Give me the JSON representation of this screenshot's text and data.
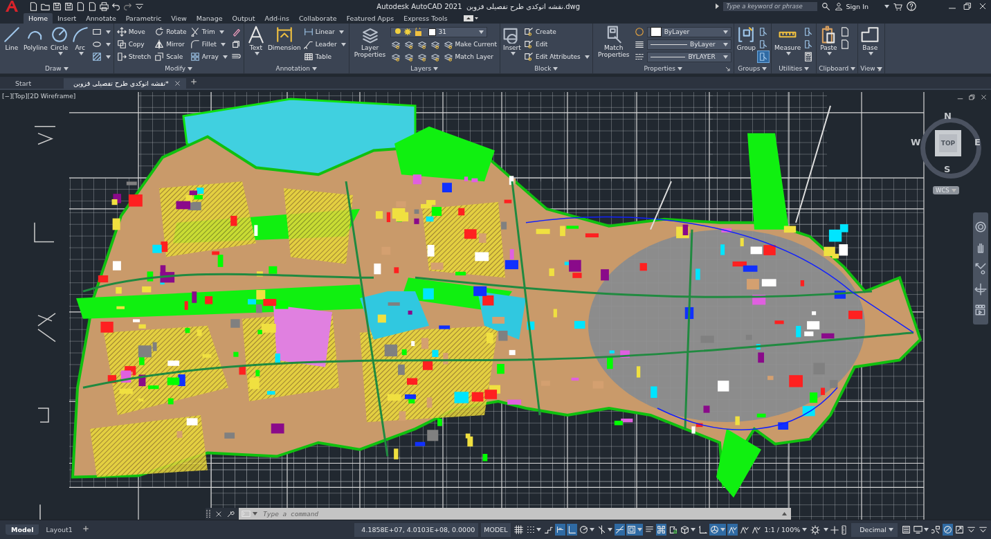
{
  "title_bar": {
    "app_title": "Autodesk AutoCAD 2021",
    "file_name": "نقشه اتوکدی طرح تفصیلی قزوین.dwg",
    "search_placeholder": "Type a keyword or phrase",
    "sign_in": "Sign In"
  },
  "ribbon_tabs": [
    {
      "label": "Home",
      "selected": true
    },
    {
      "label": "Insert",
      "selected": false
    },
    {
      "label": "Annotate",
      "selected": false
    },
    {
      "label": "Parametric",
      "selected": false
    },
    {
      "label": "View",
      "selected": false
    },
    {
      "label": "Manage",
      "selected": false
    },
    {
      "label": "Output",
      "selected": false
    },
    {
      "label": "Add-ins",
      "selected": false
    },
    {
      "label": "Collaborate",
      "selected": false
    },
    {
      "label": "Featured Apps",
      "selected": false
    },
    {
      "label": "Express Tools",
      "selected": false
    }
  ],
  "ribbon_panels": [
    {
      "title": "Draw",
      "launcher": false,
      "large": [
        {
          "label": "Line",
          "dropdown": false
        },
        {
          "label": "Polyline",
          "dropdown": false
        },
        {
          "label": "Circle",
          "dropdown": true
        },
        {
          "label": "Arc",
          "dropdown": true
        }
      ],
      "rows": [
        [
          {
            "kind": "icon",
            "dropdown": true,
            "on": false
          }
        ],
        [
          {
            "kind": "icon",
            "dropdown": true,
            "on": false
          }
        ],
        [
          {
            "kind": "icon",
            "dropdown": true,
            "on": false
          }
        ]
      ]
    },
    {
      "title": "Modify",
      "launcher": false,
      "rows": [
        [
          {
            "kind": "button",
            "label": "Move",
            "dropdown": false
          },
          {
            "kind": "button",
            "label": "Rotate",
            "dropdown": false
          },
          {
            "kind": "button",
            "label": "Trim",
            "dropdown": true
          },
          {
            "kind": "icon",
            "dropdown": false,
            "on": false
          }
        ],
        [
          {
            "kind": "button",
            "label": "Copy",
            "dropdown": false
          },
          {
            "kind": "button",
            "label": "Mirror",
            "dropdown": false
          },
          {
            "kind": "button",
            "label": "Fillet",
            "dropdown": true
          },
          {
            "kind": "icon",
            "dropdown": false,
            "on": false
          }
        ],
        [
          {
            "kind": "button",
            "label": "Stretch",
            "dropdown": false
          },
          {
            "kind": "button",
            "label": "Scale",
            "dropdown": false
          },
          {
            "kind": "button",
            "label": "Array",
            "dropdown": true
          },
          {
            "kind": "icon",
            "dropdown": false,
            "on": false
          }
        ]
      ]
    },
    {
      "title": "Annotation",
      "launcher": false,
      "large": [
        {
          "label": "Text",
          "dropdown": true
        },
        {
          "label": "Dimension",
          "dropdown": false
        }
      ],
      "rows": [
        [
          {
            "kind": "button",
            "label": "Linear",
            "dropdown": true
          }
        ],
        [
          {
            "kind": "button",
            "label": "Leader",
            "dropdown": true
          }
        ],
        [
          {
            "kind": "button",
            "label": "Table",
            "dropdown": false
          }
        ]
      ]
    },
    {
      "title": "Layers",
      "launcher": false,
      "large": [
        {
          "label": "Layer Properties",
          "dropdown": false
        }
      ],
      "rows": [
        [
          {
            "kind": "layer-select",
            "value": "31"
          }
        ],
        [
          {
            "kind": "icon",
            "dropdown": false,
            "on": false
          },
          {
            "kind": "icon",
            "dropdown": false,
            "on": false
          },
          {
            "kind": "icon",
            "dropdown": false,
            "on": false
          },
          {
            "kind": "icon",
            "dropdown": false,
            "on": false
          },
          {
            "kind": "button",
            "label": "Make Current",
            "dropdown": false
          }
        ],
        [
          {
            "kind": "icon",
            "dropdown": false,
            "on": false
          },
          {
            "kind": "icon",
            "dropdown": false,
            "on": false
          },
          {
            "kind": "icon",
            "dropdown": false,
            "on": false
          },
          {
            "kind": "icon",
            "dropdown": false,
            "on": false
          },
          {
            "kind": "button",
            "label": "Match Layer",
            "dropdown": false
          }
        ]
      ]
    },
    {
      "title": "Block",
      "launcher": false,
      "large": [
        {
          "label": "Insert",
          "dropdown": true
        }
      ],
      "rows": [
        [
          {
            "kind": "button",
            "label": "Create",
            "dropdown": false
          }
        ],
        [
          {
            "kind": "button",
            "label": "Edit",
            "dropdown": false
          }
        ],
        [
          {
            "kind": "button",
            "label": "Edit Attributes",
            "dropdown": true
          }
        ]
      ]
    },
    {
      "title": "Properties",
      "launcher": true,
      "large": [
        {
          "label": "Match Properties",
          "dropdown": false
        }
      ],
      "rows": [
        [
          {
            "kind": "icon",
            "dropdown": false,
            "on": false
          },
          {
            "kind": "color-select",
            "value": "ByLayer"
          }
        ],
        [
          {
            "kind": "icon",
            "dropdown": false,
            "on": false
          },
          {
            "kind": "line-select",
            "value": "ByLayer"
          }
        ],
        [
          {
            "kind": "icon",
            "dropdown": false,
            "on": false
          },
          {
            "kind": "line-select",
            "value": "BYLAYER"
          }
        ]
      ]
    },
    {
      "title": "Groups",
      "launcher": false,
      "large": [
        {
          "label": "Group",
          "dropdown": false
        }
      ],
      "rows": [
        [
          {
            "kind": "icon",
            "dropdown": false,
            "on": false
          }
        ],
        [
          {
            "kind": "icon",
            "dropdown": false,
            "on": false
          }
        ],
        [
          {
            "kind": "icon",
            "dropdown": false,
            "on": true
          }
        ]
      ]
    },
    {
      "title": "Utilities",
      "launcher": false,
      "large": [
        {
          "label": "Measure",
          "dropdown": true
        }
      ],
      "rows": [
        [
          {
            "kind": "icon",
            "dropdown": false,
            "on": false
          }
        ],
        [
          {
            "kind": "icon",
            "dropdown": false,
            "on": false
          }
        ],
        [
          {
            "kind": "icon",
            "dropdown": false,
            "on": false
          }
        ]
      ]
    },
    {
      "title": "Clipboard",
      "launcher": false,
      "large": [
        {
          "label": "Paste",
          "dropdown": true
        }
      ],
      "rows": [
        [
          {
            "kind": "icon",
            "dropdown": false,
            "on": false
          }
        ],
        [
          {
            "kind": "icon",
            "dropdown": false,
            "on": false
          }
        ]
      ]
    },
    {
      "title": "View",
      "launcher": true,
      "large": [
        {
          "label": "Base",
          "dropdown": true
        }
      ]
    }
  ],
  "document_tabs": [
    {
      "label": "Start",
      "selected": false,
      "closable": false
    },
    {
      "label": "نقشه اتوکدی طرح تفصیلی قزوین*",
      "selected": true,
      "closable": true
    }
  ],
  "viewport": {
    "controls": "[−][Top][2D Wireframe]",
    "viewcube": {
      "north": "N",
      "west": "W",
      "east": "E",
      "south": "S",
      "face": "TOP"
    },
    "ucs": "WCS"
  },
  "command_line": {
    "placeholder": "Type a command"
  },
  "layout_tabs": [
    {
      "label": "Model",
      "selected": true
    },
    {
      "label": "Layout1",
      "selected": false
    }
  ],
  "status_bar": {
    "coordinates": "4.1858E+07, 4.0103E+08, 0.0000",
    "space": "MODEL",
    "toggles": [
      {
        "on": false,
        "dropdown": false
      },
      {
        "on": false,
        "dropdown": true
      },
      {
        "on": false,
        "dropdown": false
      },
      {
        "on": true,
        "dropdown": false
      },
      {
        "on": true,
        "dropdown": false
      },
      {
        "on": false,
        "dropdown": true
      },
      {
        "on": false,
        "dropdown": true
      },
      {
        "on": true,
        "dropdown": false
      },
      {
        "on": true,
        "dropdown": true
      },
      {
        "on": false,
        "dropdown": false
      },
      {
        "on": true,
        "dropdown": false
      },
      {
        "on": false,
        "dropdown": false
      },
      {
        "on": false,
        "dropdown": true
      },
      {
        "on": false,
        "dropdown": false
      },
      {
        "on": true,
        "dropdown": true
      },
      {
        "on": true,
        "dropdown": false
      },
      {
        "on": false,
        "dropdown": false
      },
      {
        "on": false,
        "dropdown": false
      }
    ],
    "annotation_scale": "1:1 / 100%",
    "units": "Decimal",
    "end_toggles": [
      {
        "on": false,
        "dropdown": false
      },
      {
        "on": false,
        "dropdown": true
      },
      {
        "on": false,
        "dropdown": false
      },
      {
        "on": true,
        "dropdown": false
      },
      {
        "on": false,
        "dropdown": false
      },
      {
        "on": false,
        "dropdown": false
      },
      {
        "on": false,
        "dropdown": false
      }
    ]
  }
}
